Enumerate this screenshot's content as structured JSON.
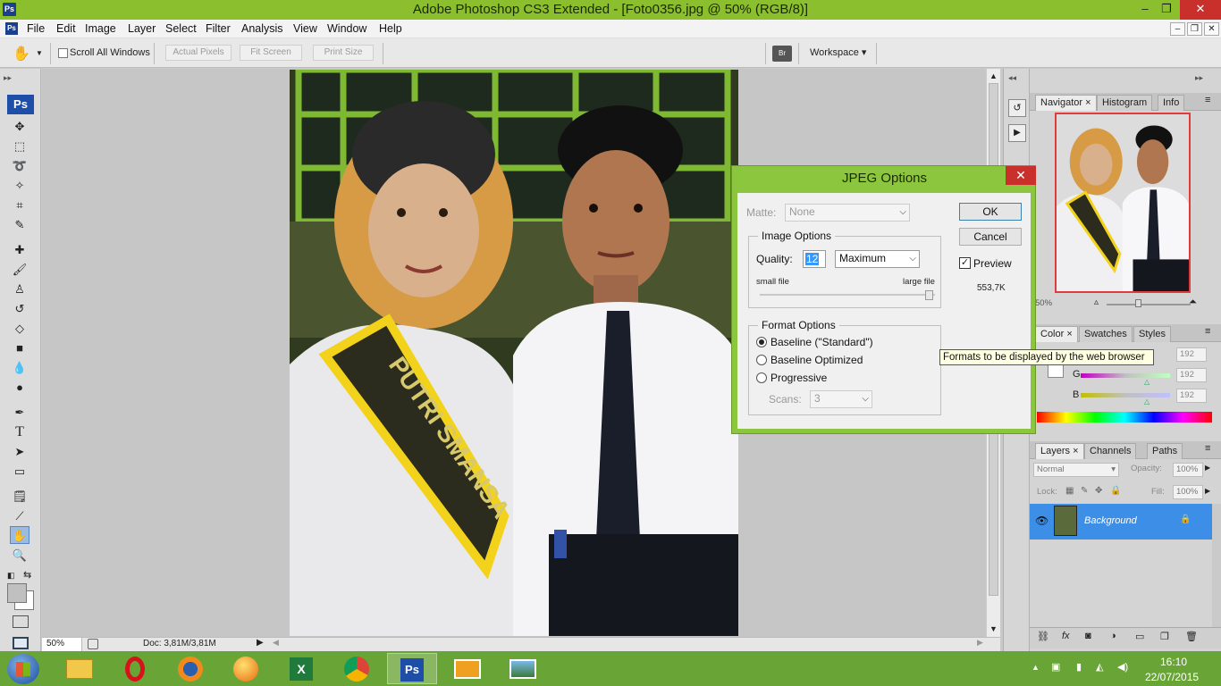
{
  "window": {
    "title": "Adobe Photoshop CS3 Extended - [Foto0356.jpg @ 50% (RGB/8)]",
    "app_icon": "Ps",
    "controls": [
      "–",
      "❐",
      "✕"
    ]
  },
  "menu": {
    "items": [
      "File",
      "Edit",
      "Image",
      "Layer",
      "Select",
      "Filter",
      "Analysis",
      "View",
      "Window",
      "Help"
    ],
    "doc_controls": [
      "–",
      "❐",
      "✕"
    ]
  },
  "options_bar": {
    "scroll_all_windows": "Scroll All Windows",
    "actual_pixels": "Actual Pixels",
    "fit_screen": "Fit Screen",
    "print_size": "Print Size",
    "workspace": "Workspace"
  },
  "toolbox": {
    "logo": "Ps",
    "tools": [
      "move",
      "marquee",
      "lasso",
      "magic-wand",
      "crop",
      "slice",
      "healing",
      "brush",
      "stamp",
      "history-brush",
      "eraser",
      "gradient",
      "blur",
      "dodge",
      "pen",
      "type",
      "path-select",
      "shape",
      "notes",
      "eyedropper",
      "hand",
      "zoom"
    ]
  },
  "status": {
    "zoom": "50%",
    "doc": "Doc: 3,81M/3,81M"
  },
  "navigator": {
    "tabs": [
      "Navigator",
      "Histogram",
      "Info"
    ],
    "zoom": "50%"
  },
  "color_panel": {
    "tabs": [
      "Color",
      "Swatches",
      "Styles"
    ],
    "channels": [
      {
        "label": "R",
        "value": "192"
      },
      {
        "label": "G",
        "value": "192"
      },
      {
        "label": "B",
        "value": "192"
      }
    ]
  },
  "layers_panel": {
    "tabs": [
      "Layers",
      "Channels",
      "Paths"
    ],
    "blend_mode": "Normal",
    "opacity_label": "Opacity:",
    "opacity": "100%",
    "lock_label": "Lock:",
    "fill_label": "Fill:",
    "fill": "100%",
    "layer_name": "Background"
  },
  "dialog": {
    "title": "JPEG Options",
    "matte_label": "Matte:",
    "matte_value": "None",
    "ok": "OK",
    "cancel": "Cancel",
    "preview_label": "Preview",
    "file_size": "553,7K",
    "image_options": {
      "legend": "Image Options",
      "quality_label": "Quality:",
      "quality_value": "12",
      "quality_preset": "Maximum",
      "small_file": "small file",
      "large_file": "large file",
      "quality_fraction": 1.0
    },
    "format_options": {
      "legend": "Format Options",
      "baseline_standard": "Baseline (\"Standard\")",
      "baseline_optimized": "Baseline Optimized",
      "progressive": "Progressive",
      "scans_label": "Scans:",
      "scans_value": "3"
    }
  },
  "tooltip": "Formats to be displayed by the web browser",
  "photo": {
    "sash_text": "PUTRI SMANSA"
  },
  "taskbar": {
    "time": "16:10",
    "date": "22/07/2015"
  }
}
